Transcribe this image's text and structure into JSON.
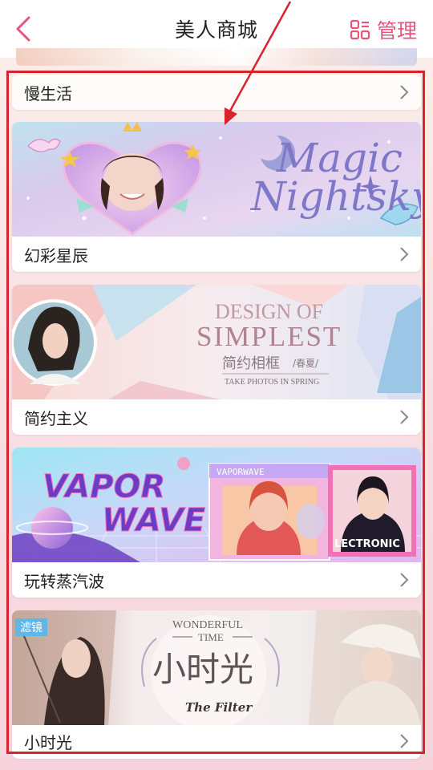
{
  "header": {
    "title": "美人商城",
    "manage_label": "管理"
  },
  "items": [
    {
      "label": "慢生活"
    },
    {
      "label": "幻彩星辰",
      "banner": {
        "line1": "Magic",
        "line2": "Nightsky"
      }
    },
    {
      "label": "简约主义",
      "banner": {
        "line1": "DESIGN OF",
        "line2": "SIMPLEST",
        "line3": "简约相框",
        "line3b": "/春夏/",
        "line4": "TAKE PHOTOS IN SPRING"
      }
    },
    {
      "label": "玩转蒸汽波",
      "banner": {
        "line1": "VAPOR",
        "line2": "WAVE",
        "window_title": "VAPORWAVE",
        "tag": "LECTRONIC"
      }
    },
    {
      "label": "小时光",
      "tag": "滤镜",
      "banner": {
        "line1": "WONDERFUL",
        "line2": "TIME",
        "line3": "小时光",
        "line4": "The Filter"
      }
    }
  ],
  "colors": {
    "accent": "#e8557c",
    "annotation": "#d8232f",
    "tag_bg": "#5fb6e8"
  },
  "icons": {
    "back": "chevron-left-icon",
    "manage": "grid-manage-icon",
    "row": "chevron-right-icon"
  }
}
